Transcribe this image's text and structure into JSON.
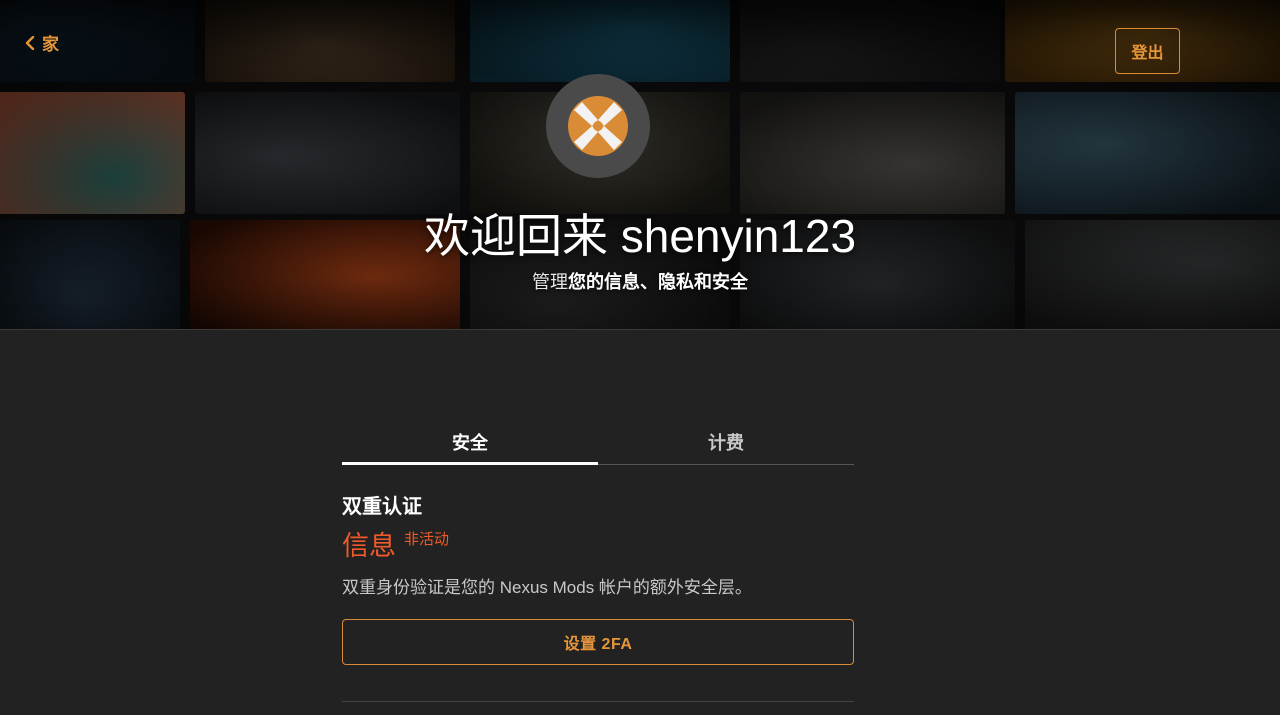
{
  "header": {
    "back_label": "家",
    "logout_label": "登出",
    "welcome": "欢迎回来 shenyin123",
    "subtitle_plain": "管理",
    "subtitle_bold": "您的信息、隐私和安全"
  },
  "tabs": [
    {
      "label": "安全",
      "active": true
    },
    {
      "label": "计费",
      "active": false
    }
  ],
  "two_factor": {
    "title": "双重认证",
    "status": "信息",
    "status_badge": "非活动",
    "description": "双重身份验证是您的 Nexus Mods 帐户的额外安全层。",
    "setup_label": "设置 2FA"
  },
  "colors": {
    "accent": "#e6963a",
    "alert": "#f05a2a",
    "page_bg": "#222222"
  },
  "icons": {
    "back": "chevron-left-icon",
    "avatar": "nexus-logo-icon"
  }
}
